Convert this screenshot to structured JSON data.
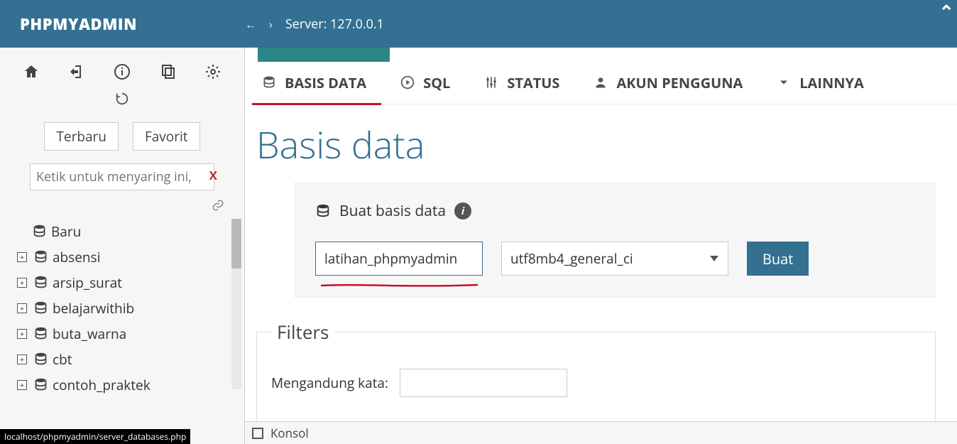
{
  "brand": "PHPMYADMIN",
  "breadcrumb": {
    "server_label": "Server: 127.0.0.1"
  },
  "sidebar": {
    "tabs": {
      "recent": "Terbaru",
      "favorite": "Favorit"
    },
    "filter_placeholder": "Ketik untuk menyaring ini, tek",
    "items": [
      {
        "name": "Baru",
        "expandable": false
      },
      {
        "name": "absensi",
        "expandable": true
      },
      {
        "name": "arsip_surat",
        "expandable": true
      },
      {
        "name": "belajarwithib",
        "expandable": true
      },
      {
        "name": "buta_warna",
        "expandable": true
      },
      {
        "name": "cbt",
        "expandable": true
      },
      {
        "name": "contoh_praktek",
        "expandable": true
      }
    ]
  },
  "tabs": {
    "database": "BASIS DATA",
    "sql": "SQL",
    "status": "STATUS",
    "users": "AKUN PENGGUNA",
    "more": "LAINNYA"
  },
  "page_title": "Basis data",
  "create": {
    "heading": "Buat basis data",
    "name_value": "latihan_phpmyadmin",
    "collation": "utf8mb4_general_ci",
    "button": "Buat"
  },
  "filters": {
    "legend": "Filters",
    "contains_label": "Mengandung kata:"
  },
  "konsol": "Konsol",
  "status_url": "localhost/phpmyadmin/server_databases.php"
}
